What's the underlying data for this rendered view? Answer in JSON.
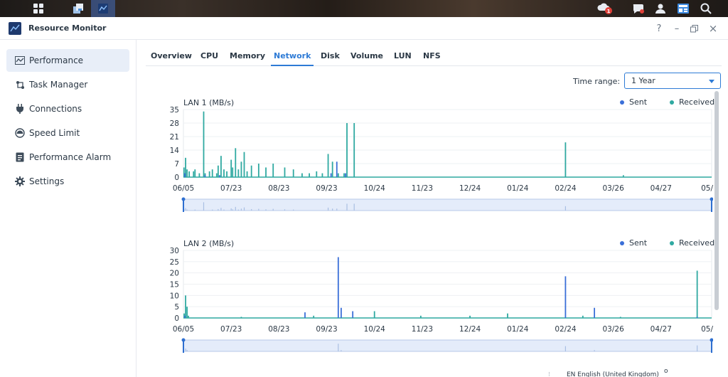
{
  "window": {
    "title": "Resource Monitor"
  },
  "taskbar": {
    "left_icons": [
      "apps-grid-icon",
      "package-center-icon",
      "resource-monitor-icon"
    ],
    "right_icons": [
      "notification-cloud-icon",
      "chat-icon",
      "user-icon",
      "widgets-icon",
      "search-icon"
    ],
    "notification_badge": "1"
  },
  "window_controls": {
    "help": "?",
    "minimize": "–",
    "restore": "⧉",
    "close": "×"
  },
  "sidebar": {
    "items": [
      {
        "label": "Performance",
        "icon": "performance-icon",
        "active": true
      },
      {
        "label": "Task Manager",
        "icon": "task-manager-icon",
        "active": false
      },
      {
        "label": "Connections",
        "icon": "plug-icon",
        "active": false
      },
      {
        "label": "Speed Limit",
        "icon": "speedometer-icon",
        "active": false
      },
      {
        "label": "Performance Alarm",
        "icon": "alarm-doc-icon",
        "active": false
      },
      {
        "label": "Settings",
        "icon": "gear-icon",
        "active": false
      }
    ]
  },
  "tabs": [
    {
      "label": "Overview",
      "active": false
    },
    {
      "label": "CPU",
      "active": false
    },
    {
      "label": "Memory",
      "active": false
    },
    {
      "label": "Network",
      "active": true
    },
    {
      "label": "Disk",
      "active": false
    },
    {
      "label": "Volume",
      "active": false
    },
    {
      "label": "LUN",
      "active": false
    },
    {
      "label": "NFS",
      "active": false
    }
  ],
  "time_range": {
    "label": "Time range:",
    "value": "1 Year"
  },
  "legend": {
    "sent": "Sent",
    "received": "Received"
  },
  "colors": {
    "accent": "#2e7bd6",
    "sent": "#3a6fd8",
    "received": "#2fa9a1",
    "navigator_fill": "#e4ecfa"
  },
  "footer": {
    "separator": "⁝",
    "language": "EN English (United Kingdom)",
    "extra": "o"
  },
  "chart_data": [
    {
      "type": "bar",
      "title": "LAN 1 (MB/s)",
      "ylim": [
        0,
        35
      ],
      "y_ticks": [
        0,
        7,
        14,
        21,
        28,
        35
      ],
      "x_tick_labels": [
        "06/05",
        "07/23",
        "08/23",
        "09/23",
        "10/24",
        "11/23",
        "12/24",
        "01/24",
        "02/24",
        "03/26",
        "04/27",
        "05/"
      ],
      "grid": true,
      "legend_position": "top-right",
      "series": [
        {
          "name": "Received",
          "color": "#2fa9a1",
          "points": [
            [
              0.4,
              5
            ],
            [
              1.5,
              10
            ],
            [
              2.5,
              4
            ],
            [
              4,
              3
            ],
            [
              7,
              3
            ],
            [
              8,
              4
            ],
            [
              11,
              2
            ],
            [
              14,
              34
            ],
            [
              15,
              2
            ],
            [
              18,
              3
            ],
            [
              20,
              4
            ],
            [
              23,
              2
            ],
            [
              24,
              6
            ],
            [
              26,
              11
            ],
            [
              28,
              4
            ],
            [
              30,
              3
            ],
            [
              33,
              9
            ],
            [
              34,
              5
            ],
            [
              36,
              15
            ],
            [
              38,
              4
            ],
            [
              40,
              8
            ],
            [
              42,
              13
            ],
            [
              44,
              3
            ],
            [
              47,
              6
            ],
            [
              52,
              7
            ],
            [
              57,
              5
            ],
            [
              62,
              7
            ],
            [
              70,
              5
            ],
            [
              76,
              4
            ],
            [
              82,
              2
            ],
            [
              87,
              2
            ],
            [
              92,
              3
            ],
            [
              96,
              2
            ],
            [
              100,
              12
            ],
            [
              103,
              8
            ],
            [
              107,
              2
            ],
            [
              111,
              2
            ],
            [
              113,
              28
            ],
            [
              118,
              28
            ],
            [
              264,
              18
            ],
            [
              304,
              1
            ]
          ]
        },
        {
          "name": "Sent",
          "color": "#3a6fd8",
          "points": [
            [
              1,
              2
            ],
            [
              15,
              1
            ],
            [
              25,
              1
            ],
            [
              102,
              2
            ],
            [
              106,
              8
            ],
            [
              112,
              2
            ]
          ]
        }
      ]
    },
    {
      "type": "bar",
      "title": "LAN 2 (MB/s)",
      "ylim": [
        0,
        30
      ],
      "y_ticks": [
        0,
        5,
        10,
        15,
        20,
        25,
        30
      ],
      "x_tick_labels": [
        "06/05",
        "07/23",
        "08/23",
        "09/23",
        "10/24",
        "11/23",
        "12/24",
        "01/24",
        "02/24",
        "03/26",
        "04/27",
        "05/"
      ],
      "grid": true,
      "legend_position": "top-right",
      "series": [
        {
          "name": "Received",
          "color": "#2fa9a1",
          "points": [
            [
              0.5,
              2
            ],
            [
              1.5,
              10
            ],
            [
              2.5,
              5
            ],
            [
              3.5,
              1
            ],
            [
              40,
              0.5
            ],
            [
              90,
              1
            ],
            [
              132,
              3
            ],
            [
              164,
              1
            ],
            [
              198,
              1
            ],
            [
              224,
              2
            ],
            [
              276,
              1
            ],
            [
              302,
              0.5
            ],
            [
              355,
              21
            ]
          ]
        },
        {
          "name": "Sent",
          "color": "#3a6fd8",
          "points": [
            [
              1,
              1
            ],
            [
              84,
              2.5
            ],
            [
              107,
              27
            ],
            [
              109,
              4.5
            ],
            [
              117,
              3
            ],
            [
              264,
              18.5
            ],
            [
              284,
              4.5
            ],
            [
              355,
              0.5
            ],
            [
              368,
              1
            ]
          ]
        }
      ]
    }
  ]
}
